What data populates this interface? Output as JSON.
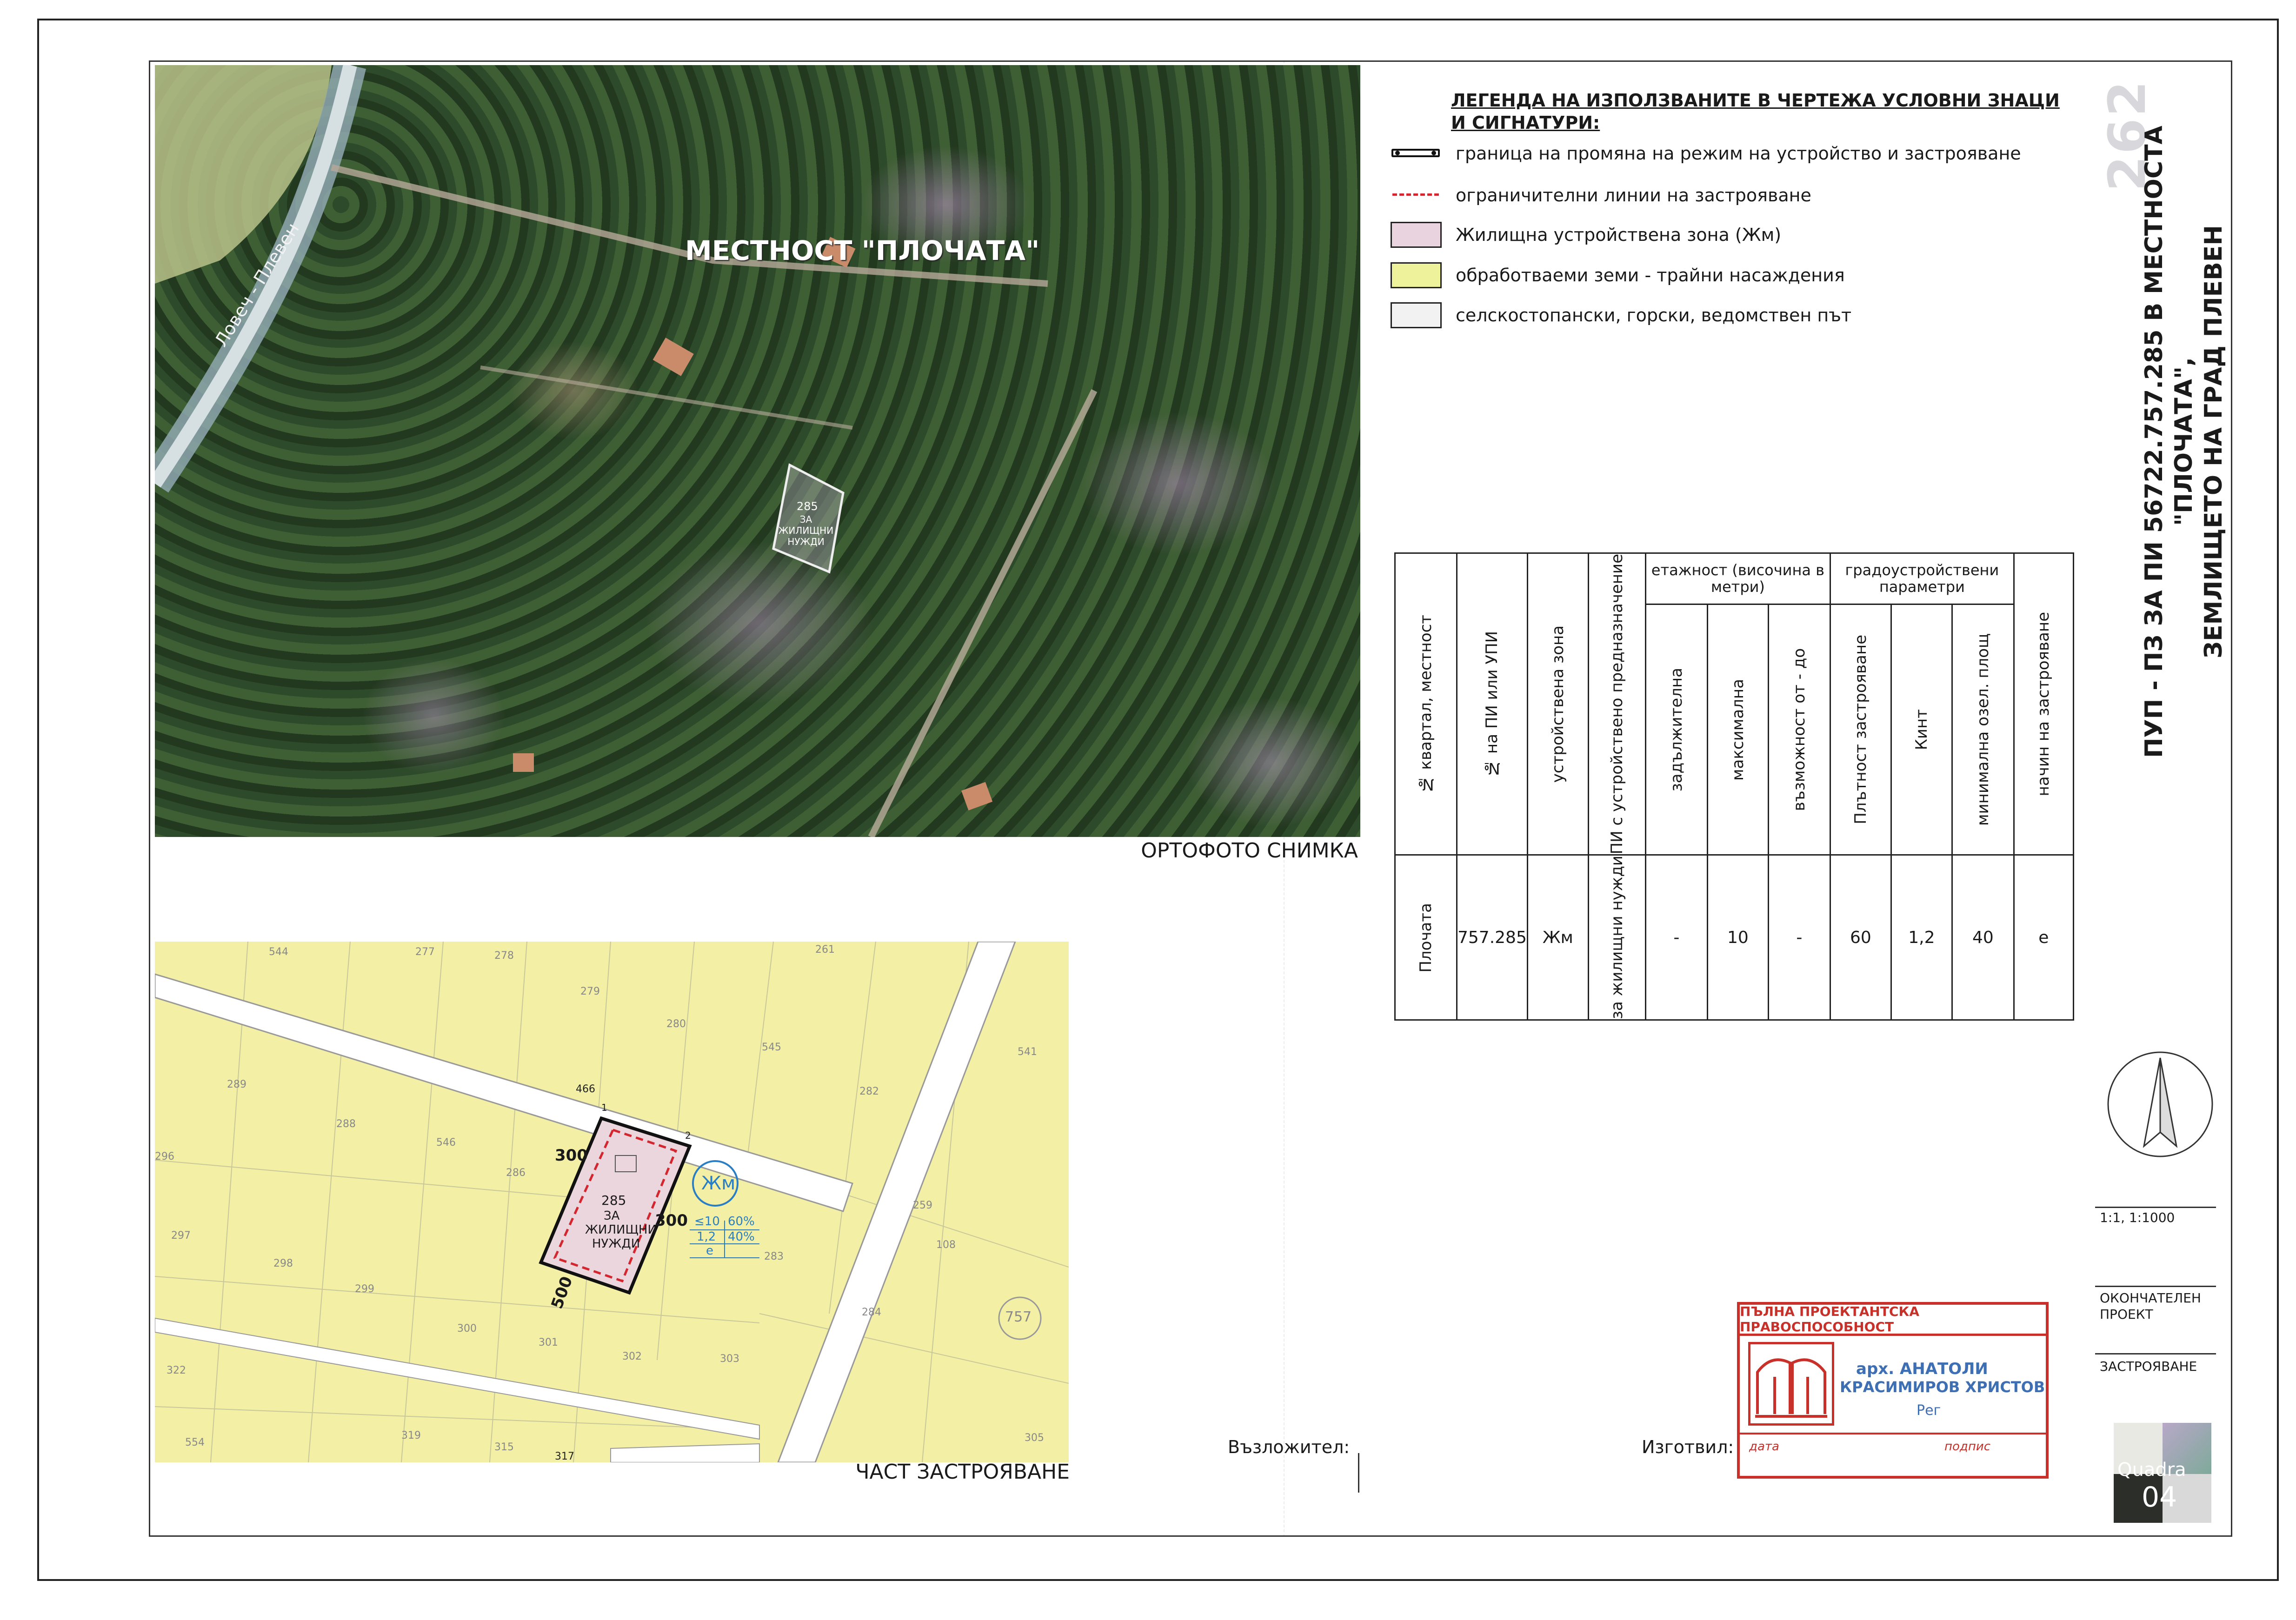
{
  "ortho": {
    "caption": "ОРТОФОТО СНИМКА",
    "locality_label": "МЕСТНОСТ \"ПЛОЧАТА\"",
    "road_label": "Ловеч - Плевен",
    "plot_number": "285",
    "plot_purpose": "ЗА ЖИЛИЩНИ НУЖДИ"
  },
  "legend": {
    "title": "ЛЕГЕНДА НА ИЗПОЛЗВАНИТЕ В ЧЕРТЕЖА УСЛОВНИ ЗНАЦИ И СИГНАТУРИ:",
    "items": [
      {
        "label": "граница на промяна на режим на устройство и застрояване"
      },
      {
        "label": "ограничителни линии на застрояване"
      },
      {
        "label": "Жилищна устройствена зона (Жм)",
        "color": "#e9d3df"
      },
      {
        "label": "обработваеми земи - трайни насаждения",
        "color": "#eef29a"
      },
      {
        "label": "селскостопански, горски, ведомствен път",
        "color": "#f2f2f2"
      }
    ]
  },
  "table": {
    "headers": {
      "kvartal": "№ квартал, местност",
      "pi": "№ на ПИ или УПИ",
      "zone": "устройствена зона",
      "purpose": "ПИ с устройствено предназначение",
      "floors_group": "етажност (височина в метри)",
      "mandatory": "задължителна",
      "maximal": "максимална",
      "possible": "възможност от - до",
      "params_group": "градоустройствени параметри",
      "density": "Плътност застрояване",
      "kint": "Кинт",
      "green": "минимална озел. площ",
      "method": "начин на застрояване"
    },
    "row": {
      "kvartal": "Плочата",
      "pi": "757.285",
      "zone": "Жм",
      "purpose": "за жилищни нужди",
      "mandatory": "-",
      "maximal": "10",
      "possible": "-",
      "density": "60",
      "kint": "1,2",
      "green": "40",
      "method": "е"
    }
  },
  "cadastre": {
    "caption": "ЧАСТ ЗАСТРОЯВАНЕ",
    "zone_badge": "Жм",
    "plot_number": "285",
    "plot_purpose_1": "ЗА",
    "plot_purpose_2": "ЖИЛИЩНИ",
    "plot_purpose_3": "НУЖДИ",
    "dim_1": "300",
    "dim_2": "300",
    "dim_3": "500",
    "param_1": "≤10",
    "param_2": "60%",
    "param_3": "1,2",
    "param_4": "40%",
    "param_5": "е",
    "point_1": "1",
    "point_2": "2",
    "land_number": "757",
    "parcels": [
      "544",
      "277",
      "278",
      "279",
      "280",
      "261",
      "545",
      "541",
      "289",
      "466",
      "288",
      "546",
      "282",
      "286",
      "296",
      "297",
      "298",
      "299",
      "300",
      "301",
      "302",
      "303",
      "283",
      "259",
      "108",
      "322",
      "554",
      "319",
      "315",
      "317",
      "305",
      "284"
    ]
  },
  "side": {
    "number": "262",
    "title_line1": "ПУП - ПЗ ЗА ПИ 56722.757.285 В МЕСТНОСТА \"ПЛОЧАТА\",",
    "title_line2": "ЗЕМЛИЩЕТО НА ГРАД ПЛЕВЕН",
    "scale": "1:1, 1:1000",
    "stage_line1": "ОКОНЧАТЕЛЕН",
    "stage_line2": "ПРОЕКТ",
    "part": "ЗАСТРОЯВАНЕ",
    "logo_text": "Quadra",
    "logo_number": "04"
  },
  "footer": {
    "client_label": "Възложител:",
    "author_label": "Изготвил:"
  },
  "stamp": {
    "title": "ПЪЛНА ПРОЕКТАНТСКА ПРАВОСПОСОБНОСТ",
    "line1": "арх. АНАТОЛИ",
    "line2": "КРАСИМИРОВ ХРИСТОВ",
    "reg": "Рег",
    "date_label": "дата",
    "sign_label": "подпис"
  }
}
